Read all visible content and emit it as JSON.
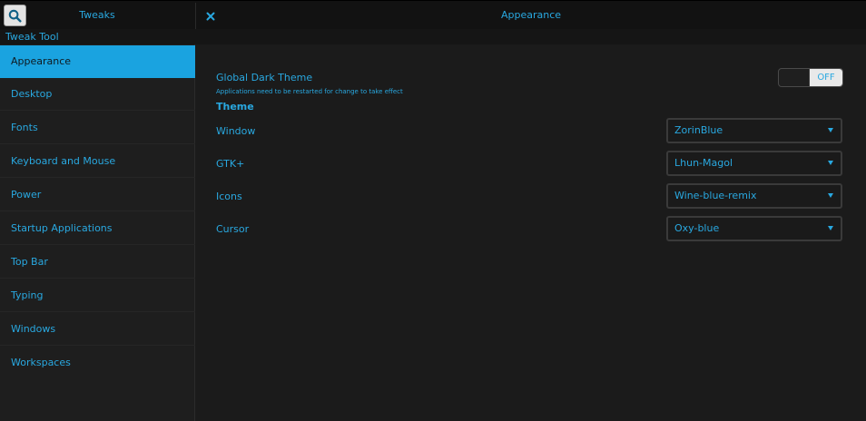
{
  "header": {
    "search_icon": "search-icon",
    "left_title": "Tweaks",
    "close_icon": "close-icon",
    "main_title": "Appearance"
  },
  "app_name": "Tweak Tool",
  "sidebar": {
    "items": [
      {
        "label": "Appearance",
        "active": true
      },
      {
        "label": "Desktop"
      },
      {
        "label": "Fonts"
      },
      {
        "label": "Keyboard and Mouse"
      },
      {
        "label": "Power"
      },
      {
        "label": "Startup Applications"
      },
      {
        "label": "Top Bar"
      },
      {
        "label": "Typing"
      },
      {
        "label": "Windows"
      },
      {
        "label": "Workspaces"
      }
    ]
  },
  "main": {
    "dark_theme": {
      "label": "Global Dark Theme",
      "note": "Applications need to be restarted for change to take effect",
      "switch_state": "OFF"
    },
    "theme_heading": "Theme",
    "rows": [
      {
        "label": "Window",
        "value": "ZorinBlue"
      },
      {
        "label": "GTK+",
        "value": "Lhun-Magol"
      },
      {
        "label": "Icons",
        "value": "Wine-blue-remix"
      },
      {
        "label": "Cursor",
        "value": "Oxy-blue"
      }
    ]
  },
  "colors": {
    "accent": "#29a8e0",
    "selected_bg": "#1aa3e0",
    "background": "#1b1b1b"
  }
}
